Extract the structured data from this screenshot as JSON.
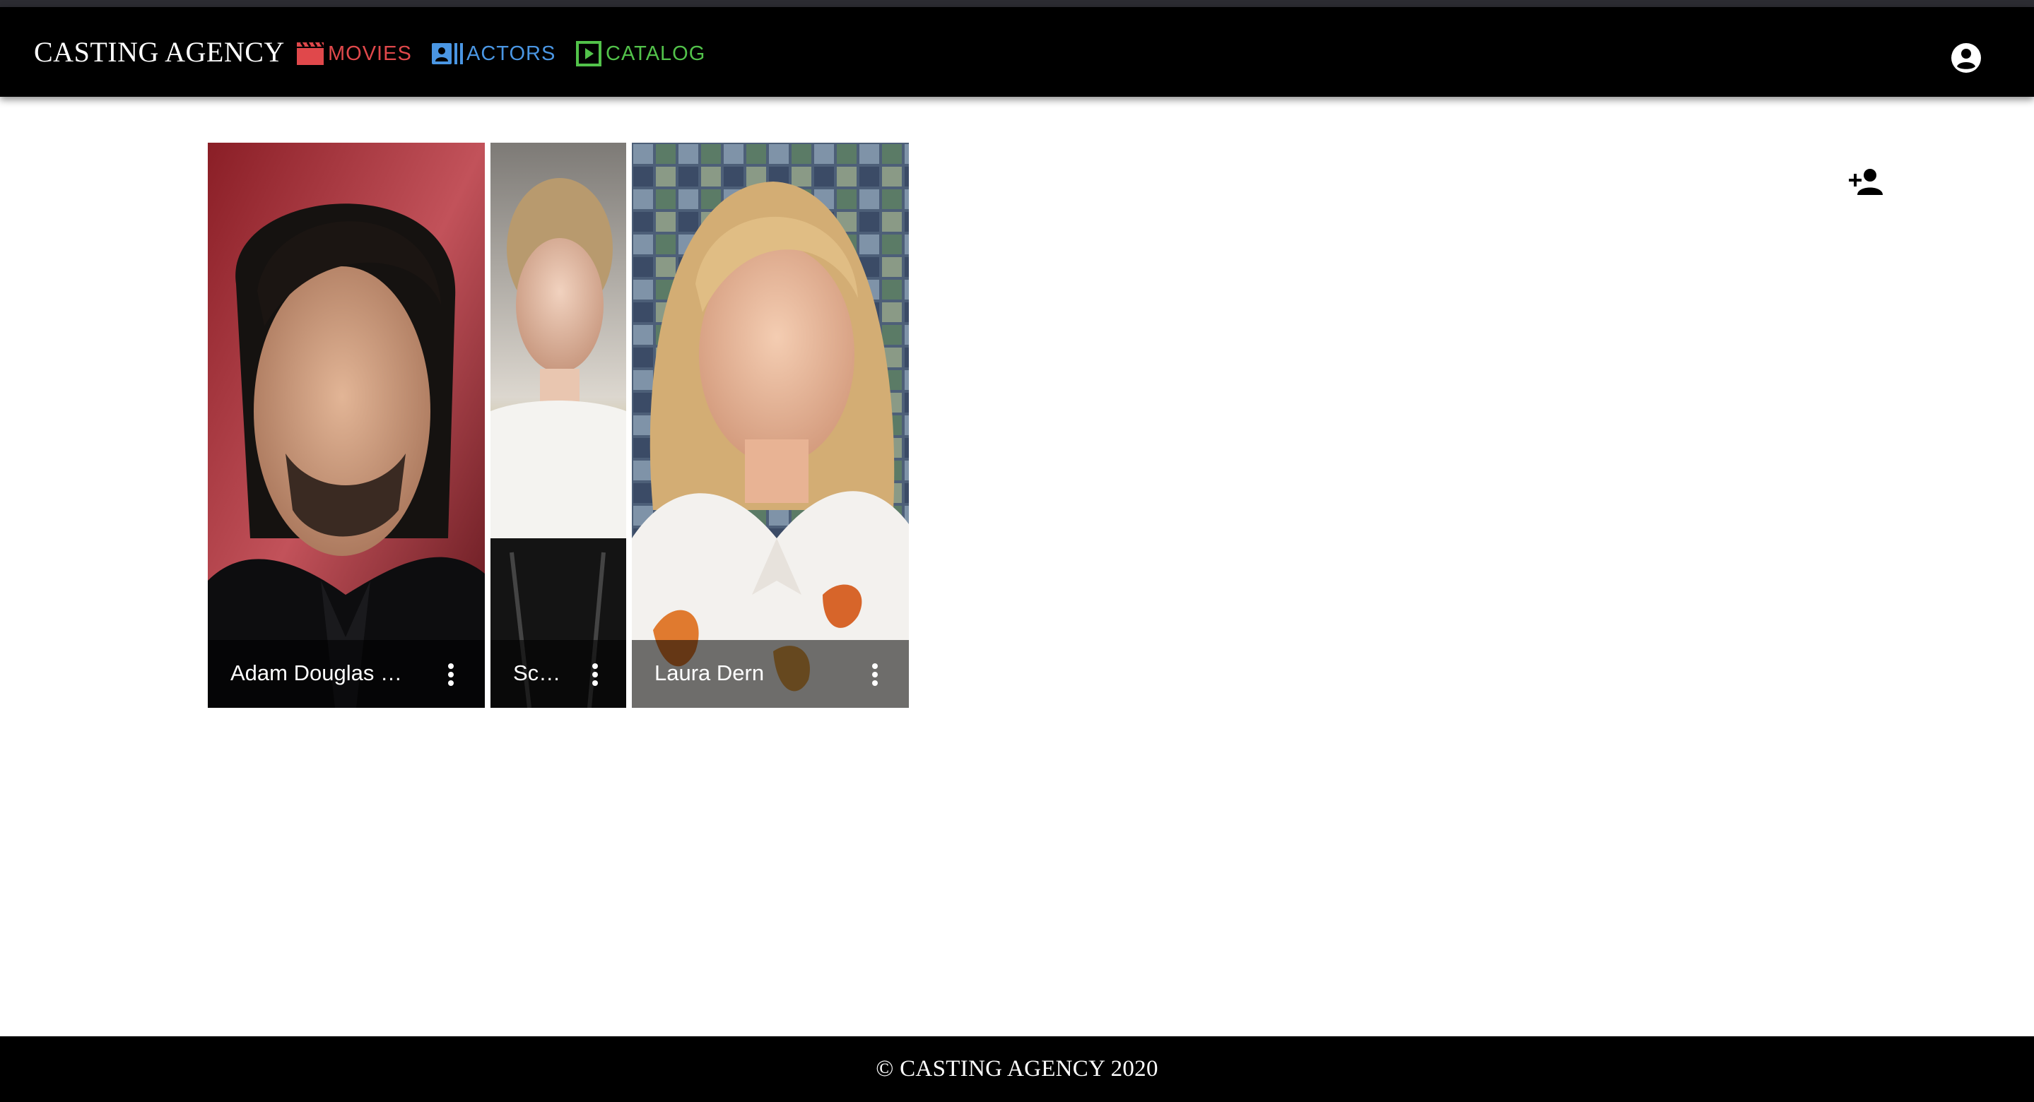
{
  "app": {
    "brand": "CASTING AGENCY"
  },
  "nav": {
    "items": [
      {
        "label": "MOVIES",
        "icon": "clapperboard-icon",
        "color": "#e0484b"
      },
      {
        "label": "ACTORS",
        "icon": "contacts-icon",
        "color": "#4a96e3"
      },
      {
        "label": "CATALOG",
        "icon": "play-box-icon",
        "color": "#52c24a"
      }
    ],
    "account_icon": "account-circle-icon"
  },
  "toolbar": {
    "add_icon": "person-add-icon"
  },
  "actors": [
    {
      "name": "Adam Douglas Driver",
      "photo": "portrait-photo",
      "menu_icon": "more-vert-icon"
    },
    {
      "name": "Scarlett Johansson",
      "photo": "portrait-photo",
      "menu_icon": "more-vert-icon"
    },
    {
      "name": "Laura Dern",
      "photo": "portrait-photo",
      "menu_icon": "more-vert-icon"
    }
  ],
  "footer": {
    "text": "© CASTING AGENCY 2020"
  }
}
